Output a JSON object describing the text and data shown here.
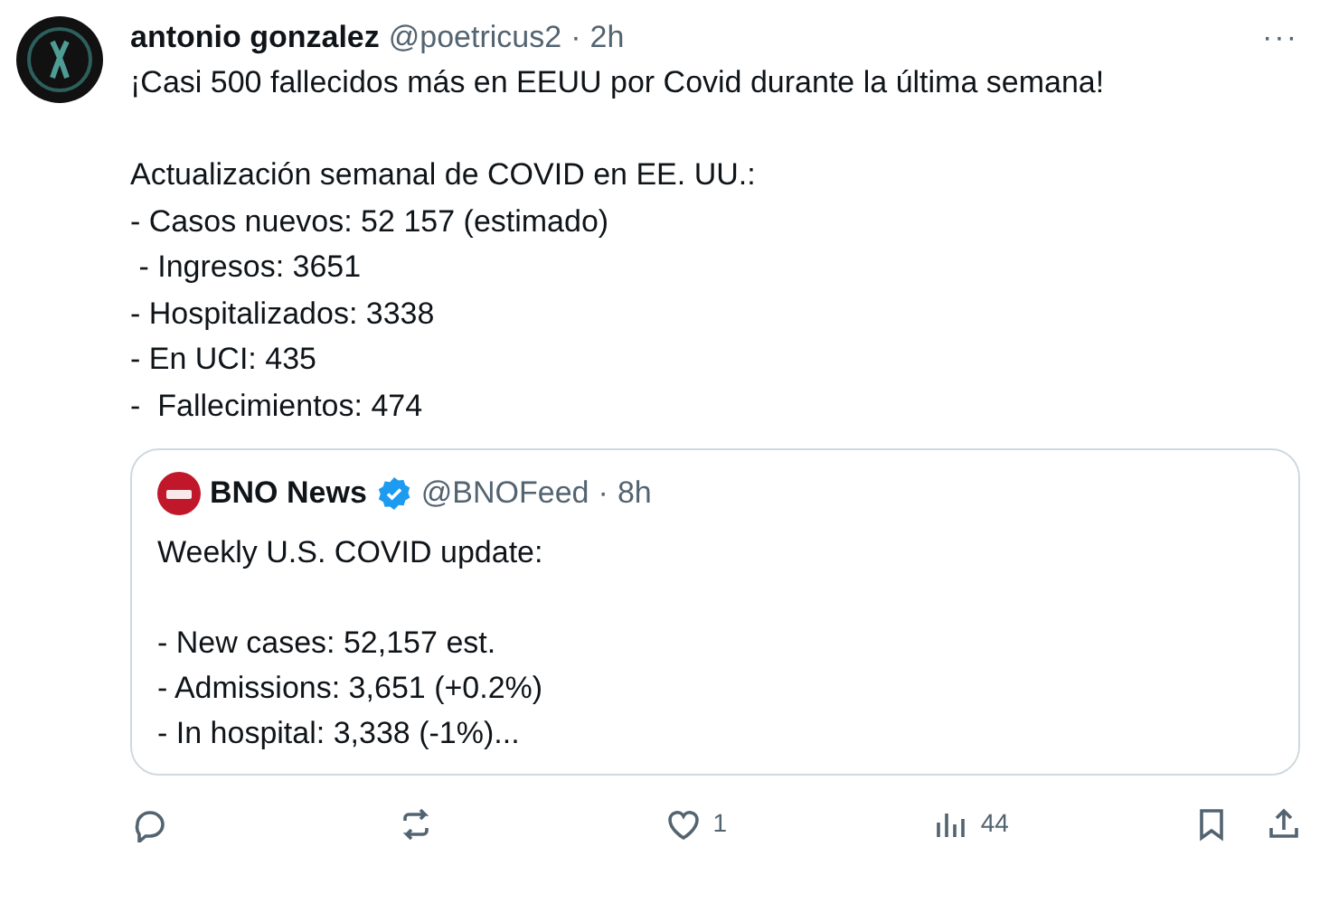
{
  "post": {
    "author": "antonio gonzalez",
    "handle": "@poetricus2",
    "separator": "·",
    "time": "2h",
    "more": "···",
    "paragraphs": [
      [
        "¡Casi 500 fallecidos más en EEUU por Covid durante la última semana!"
      ],
      [
        "Actualización semanal de COVID en EE. UU.:",
        "- Casos nuevos: 52 157 (estimado)",
        " - Ingresos: 3651",
        "- Hospitalizados: 3338",
        "- En UCI: 435",
        "-  Fallecimientos: 474"
      ]
    ]
  },
  "quote": {
    "author": "BNO News",
    "verified": true,
    "handle": "@BNOFeed",
    "separator": "·",
    "time": "8h",
    "paragraphs": [
      [
        "Weekly U.S. COVID update:"
      ],
      [
        "- New cases: 52,157 est.",
        "- Admissions: 3,651 (+0.2%)",
        "- In hospital: 3,338 (-1%)..."
      ]
    ]
  },
  "actions": [
    {
      "kind": "reply"
    },
    {
      "kind": "repost"
    },
    {
      "kind": "like",
      "count": "1"
    },
    {
      "kind": "views",
      "count": "44"
    },
    {
      "kind": "bookmark"
    },
    {
      "kind": "share"
    }
  ]
}
